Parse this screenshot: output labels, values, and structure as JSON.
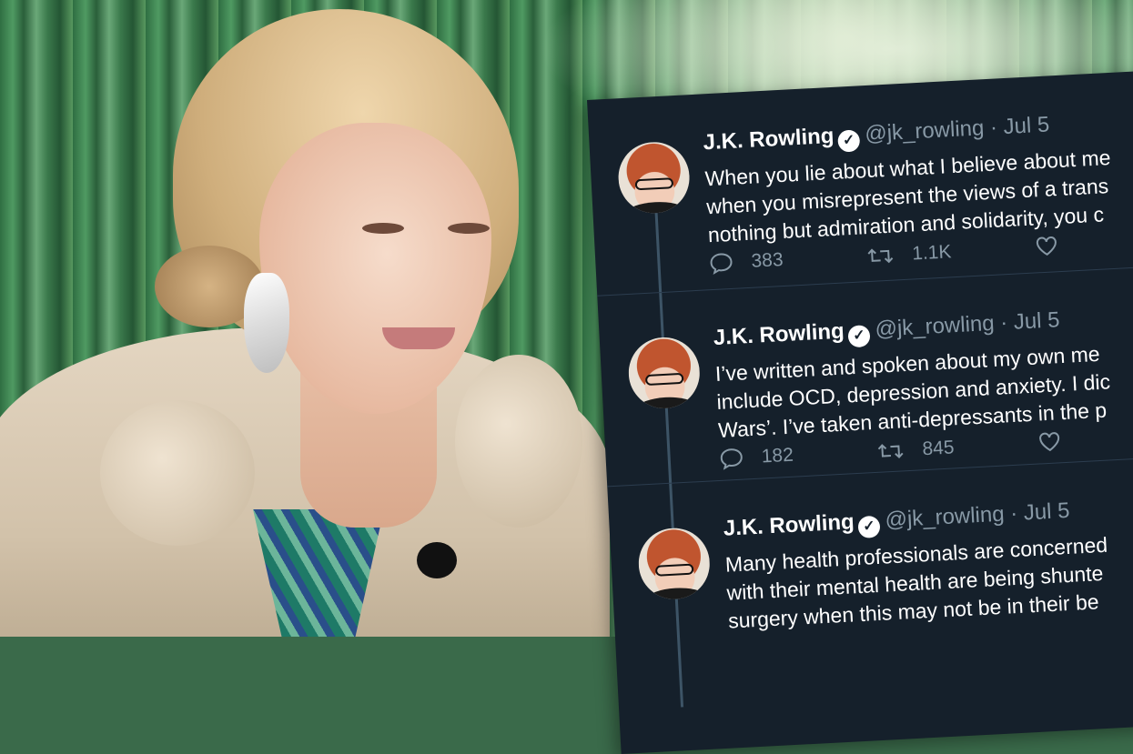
{
  "tweets": [
    {
      "name": "J.K. Rowling",
      "handle": "@jk_rowling",
      "date": "· Jul 5",
      "lines": [
        "When you lie about what I believe about me",
        "when you misrepresent the views of a trans",
        "nothing but admiration and solidarity, you c"
      ],
      "replies": "383",
      "retweets": "1.1K",
      "likes": ""
    },
    {
      "name": "J.K. Rowling",
      "handle": "@jk_rowling",
      "date": "· Jul 5",
      "lines": [
        "I’ve written and spoken about my own me",
        "include OCD, depression and anxiety. I dic",
        "Wars’. I’ve taken anti-depressants in the p"
      ],
      "replies": "182",
      "retweets": "845",
      "likes": ""
    },
    {
      "name": "J.K. Rowling",
      "handle": "@jk_rowling",
      "date": "· Jul 5",
      "lines": [
        "Many health professionals are concerned",
        "with their mental health are being shunte",
        "surgery when this may not be in their be"
      ],
      "replies": "",
      "retweets": "",
      "likes": ""
    }
  ],
  "icons": {
    "verified": "verified-badge-icon",
    "reply": "reply-icon",
    "retweet": "retweet-icon",
    "like": "heart-icon"
  },
  "colors": {
    "background": "#15202b",
    "muted_text": "#8899a6"
  }
}
